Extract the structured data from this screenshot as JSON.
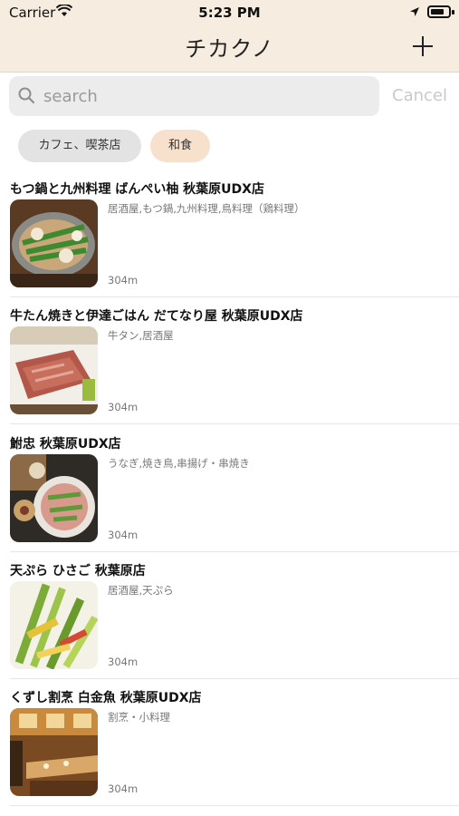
{
  "status_bar": {
    "carrier": "Carrier",
    "time": "5:23 PM"
  },
  "nav": {
    "title": "チカクノ"
  },
  "search": {
    "placeholder": "search",
    "cancel_label": "Cancel"
  },
  "chips": [
    {
      "label": "カフェ、喫茶店"
    },
    {
      "label": "和食"
    }
  ],
  "restaurants": [
    {
      "name": "もつ鍋と九州料理 ばんぺい柚 秋葉原UDX店",
      "genre": "居酒屋,もつ鍋,九州料理,鳥料理（鶏料理）",
      "distance": "304m"
    },
    {
      "name": "牛たん焼きと伊達ごはん だてなり屋 秋葉原UDX店",
      "genre": "牛タン,居酒屋",
      "distance": "304m"
    },
    {
      "name": "鮒忠 秋葉原UDX店",
      "genre": "うなぎ,焼き鳥,串揚げ・串焼き",
      "distance": "304m"
    },
    {
      "name": "天ぷら ひさご 秋葉原店",
      "genre": "居酒屋,天ぷら",
      "distance": "304m"
    },
    {
      "name": "くずし割烹 白金魚 秋葉原UDX店",
      "genre": "割烹・小料理",
      "distance": "304m"
    }
  ],
  "colors": {
    "nav_background": "#f7ece0",
    "chip_default": "#e3e3e3",
    "chip_selected": "#f7e1cd"
  }
}
